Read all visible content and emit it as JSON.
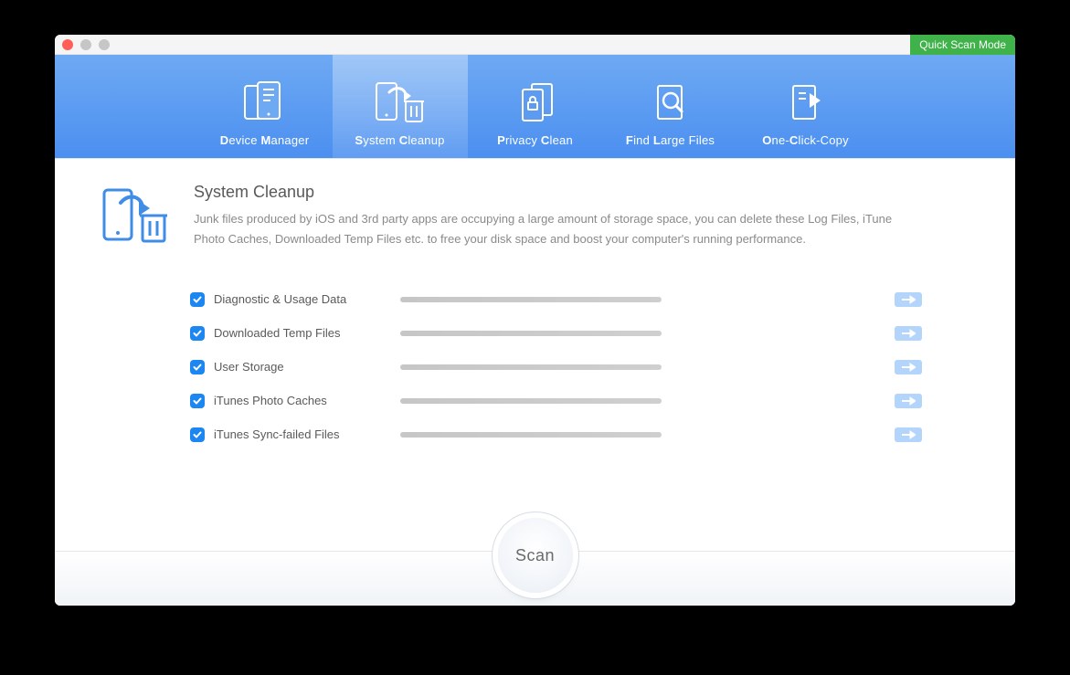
{
  "titlebar": {
    "quick_scan_label": "Quick Scan Mode"
  },
  "tabs": [
    {
      "id": "device-manager",
      "label_pre": "D",
      "label_mid": "evice ",
      "label_acc": "M",
      "label_post": "anager",
      "active": false
    },
    {
      "id": "system-cleanup",
      "label_pre": "S",
      "label_mid": "ystem ",
      "label_acc": "C",
      "label_post": "leanup",
      "active": true
    },
    {
      "id": "privacy-clean",
      "label_pre": "P",
      "label_mid": "rivacy ",
      "label_acc": "C",
      "label_post": "lean",
      "active": false
    },
    {
      "id": "find-large-files",
      "label_pre": "F",
      "label_mid": "ind ",
      "label_acc": "L",
      "label_post": "arge Files",
      "active": false
    },
    {
      "id": "one-click-copy",
      "label_pre": "O",
      "label_mid": "ne-",
      "label_acc": "C",
      "label_post": "lick-Copy",
      "active": false
    }
  ],
  "page": {
    "title": "System Cleanup",
    "description": "Junk files produced by iOS and 3rd party apps are occupying a large amount of storage space, you can delete these Log Files, iTune Photo Caches, Downloaded Temp Files etc. to free your disk space and boost your computer's running performance."
  },
  "items": [
    {
      "label": "Diagnostic & Usage Data",
      "checked": true
    },
    {
      "label": "Downloaded Temp Files",
      "checked": true
    },
    {
      "label": "User Storage",
      "checked": true
    },
    {
      "label": "iTunes Photo Caches",
      "checked": true
    },
    {
      "label": "iTunes Sync-failed Files",
      "checked": true
    }
  ],
  "scan_label": "Scan",
  "colors": {
    "accent": "#1c86f1",
    "header_top": "#6ea9f3",
    "header_bottom": "#4b8ff0",
    "quick_scan_bg": "#3fb24a"
  }
}
